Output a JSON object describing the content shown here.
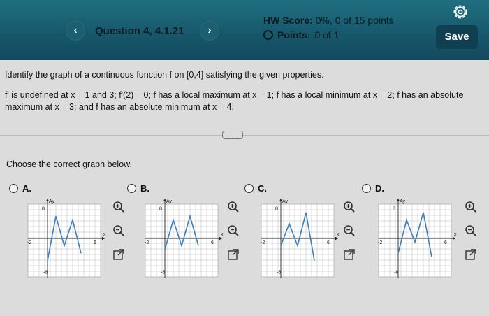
{
  "header": {
    "question_title": "Question 4, 4.1.21",
    "hw_score_label": "HW Score:",
    "hw_score_value": "0%, 0 of 15 points",
    "points_label": "Points:",
    "points_value": "0 of 1",
    "save_label": "Save",
    "prev_symbol": "‹",
    "next_symbol": "›"
  },
  "question": {
    "prompt": "Identify the graph of a continuous function f on [0,4] satisfying the given properties.",
    "properties": "f′ is undefined at x = 1 and 3; f′(2) = 0; f has a local maximum at x = 1; f has a local minimum at x = 2; f has an absolute maximum at x = 3; and f has an absolute minimum at x = 4.",
    "more_label": "....",
    "choose": "Choose the correct graph below."
  },
  "options": [
    {
      "label": "A.",
      "ytick_top": "8",
      "ytick_bottom": "-8",
      "xtick_left": "-2",
      "xtick_right": "6",
      "axis_y": "Ay",
      "axis_x": "x",
      "points": [
        [
          0,
          -6
        ],
        [
          1,
          6
        ],
        [
          2,
          -2
        ],
        [
          3,
          5
        ],
        [
          4,
          -4
        ]
      ]
    },
    {
      "label": "B.",
      "ytick_top": "8",
      "ytick_bottom": "-8",
      "xtick_left": "-2",
      "xtick_right": "6",
      "axis_y": "Ay",
      "axis_x": "x",
      "points": [
        [
          0,
          -3
        ],
        [
          1,
          5
        ],
        [
          2,
          -2
        ],
        [
          3,
          6
        ],
        [
          4,
          -2
        ]
      ]
    },
    {
      "label": "C.",
      "ytick_top": "8",
      "ytick_bottom": "-8",
      "xtick_left": "-2",
      "xtick_right": "6",
      "axis_y": "Ay",
      "axis_x": "x",
      "points": [
        [
          0,
          -2
        ],
        [
          1,
          4
        ],
        [
          2,
          -2
        ],
        [
          3,
          7
        ],
        [
          4,
          -6
        ]
      ]
    },
    {
      "label": "D.",
      "ytick_top": "8",
      "ytick_bottom": "-8",
      "xtick_left": "-2",
      "xtick_right": "6",
      "axis_y": "Ay",
      "axis_x": "x",
      "points": [
        [
          0,
          -4
        ],
        [
          1,
          5
        ],
        [
          2,
          -1
        ],
        [
          3,
          7
        ],
        [
          4,
          -5
        ]
      ]
    }
  ],
  "tools": [
    "zoom-in-icon",
    "zoom-out-icon",
    "expand-icon"
  ],
  "colors": {
    "accent": "#17566a",
    "graph_line": "#3f7fb8",
    "save_bg": "#0f3f50"
  }
}
